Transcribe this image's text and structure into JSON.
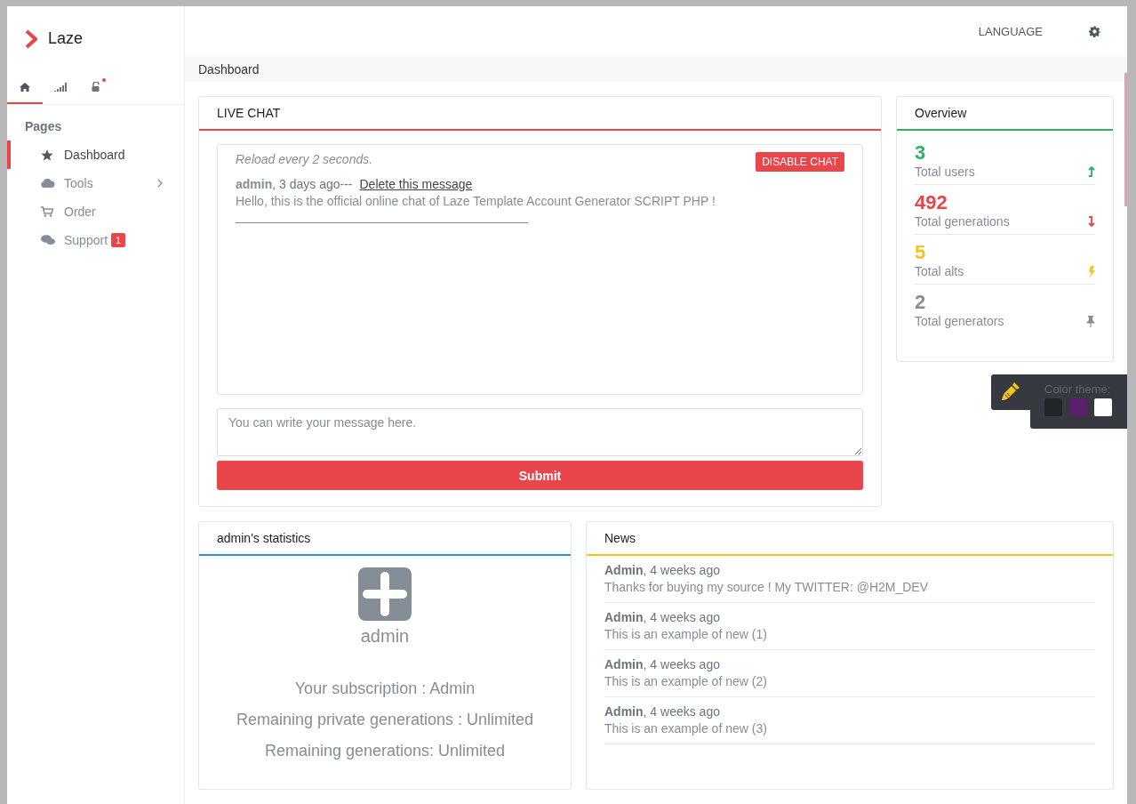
{
  "brand": {
    "name": "Laze"
  },
  "header": {
    "language": "LANGUAGE"
  },
  "sidebar": {
    "tabs": [
      {
        "kind": "home",
        "selected": true,
        "dot": false
      },
      {
        "kind": "signal",
        "selected": false,
        "dot": false
      },
      {
        "kind": "unlock",
        "selected": false,
        "dot": true
      }
    ],
    "section": "Pages",
    "items": [
      {
        "kind": "star",
        "label": "Dashboard",
        "active": true,
        "expandable": false
      },
      {
        "kind": "cloud",
        "label": "Tools",
        "active": false,
        "expandable": true
      },
      {
        "kind": "cart",
        "label": "Order",
        "active": false,
        "expandable": false
      },
      {
        "kind": "chat",
        "label": "Support",
        "active": false,
        "expandable": false,
        "badge": "1"
      }
    ]
  },
  "breadcrumb": "Dashboard",
  "live_chat": {
    "title": "LIVE CHAT",
    "color": "#e8464a",
    "reload_note": "Reload every 2 seconds.",
    "disable_button": "DISABLE CHAT",
    "messages": [
      {
        "author": "admin",
        "time": ", 3 days ago---",
        "delete_link": "Delete this message",
        "text": "Hello, this is the official online chat of Laze Template Account Generator SCRIPT PHP !"
      }
    ],
    "input": {
      "placeholder": "You can write your message here."
    },
    "submit": "Submit"
  },
  "overview": {
    "title": "Overview",
    "color": "#2eb264",
    "items": [
      {
        "value": "3",
        "label": "Total users",
        "color": "#2eb264",
        "kind": "up"
      },
      {
        "value": "492",
        "label": "Total generations",
        "color": "#e8464a",
        "kind": "down"
      },
      {
        "value": "5",
        "label": "Total alts",
        "color": "#f5c31e",
        "kind": "bolt"
      },
      {
        "value": "2",
        "label": "Total generators",
        "color": "#858e96",
        "kind": "pin"
      }
    ]
  },
  "theme_picker": {
    "label": "Color theme:",
    "swatches": [
      {
        "color": "#22252a"
      },
      {
        "color": "#5c1f6e"
      },
      {
        "color": "#ffffff"
      }
    ]
  },
  "stats": {
    "title": "admin's statistics",
    "color": "#2e8fd4",
    "username": "admin",
    "lines": [
      "Your subscription : Admin",
      "Remaining private generations : Unlimited",
      "Remaining generations: Unlimited"
    ]
  },
  "news": {
    "title": "News",
    "color": "#f5c31e",
    "items": [
      {
        "author": "Admin",
        "time": ", 4 weeks ago",
        "text": "Thanks for buying my source ! My TWITTER: @H2M_DEV"
      },
      {
        "author": "Admin",
        "time": ", 4 weeks ago",
        "text": "This is an example of new (1)"
      },
      {
        "author": "Admin",
        "time": ", 4 weeks ago",
        "text": "This is an example of new (2)"
      },
      {
        "author": "Admin",
        "time": ", 4 weeks ago",
        "text": "This is an example of new (3)"
      }
    ]
  }
}
